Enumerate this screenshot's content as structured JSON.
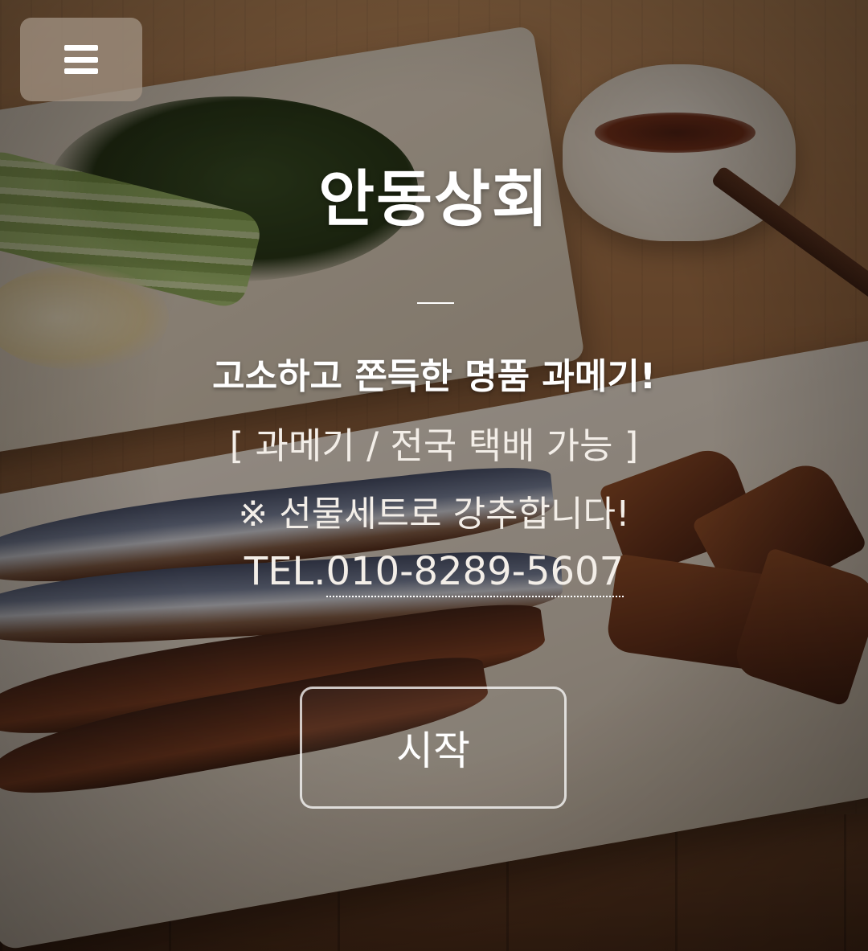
{
  "header": {
    "menu_icon": "hamburger-menu-icon"
  },
  "hero": {
    "title": "안동상회",
    "tagline": "고소하고 쫀득한 명품 과메기!",
    "subline": "[ 과메기 / 전국 택배 가능 ]",
    "note": "※ 선물세트로 강추합니다!",
    "tel_prefix": "TEL.",
    "tel_number": "010-8289-5607",
    "start_label": "시작"
  },
  "colors": {
    "text": "#ffffff",
    "menu_button_bg": "#a0918280"
  }
}
